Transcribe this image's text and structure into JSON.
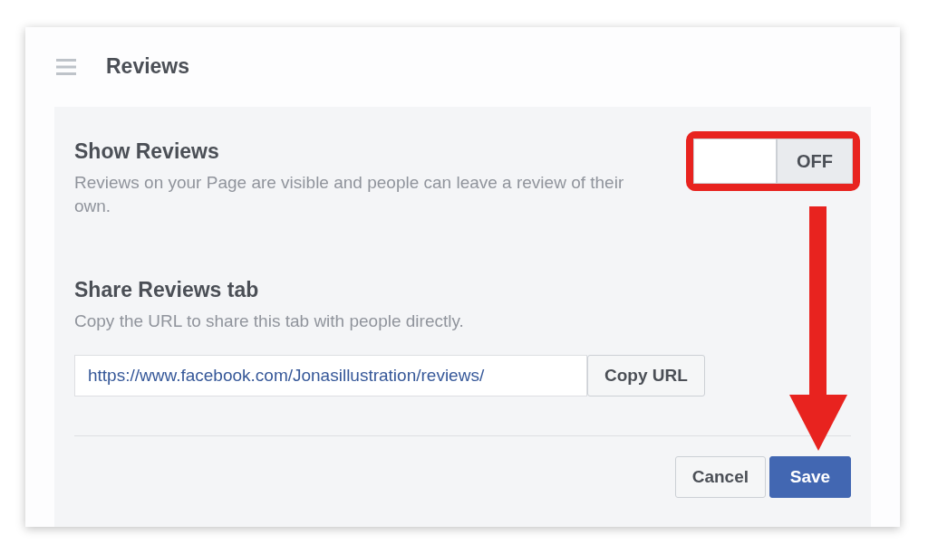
{
  "header": {
    "title": "Reviews"
  },
  "show_reviews": {
    "title": "Show Reviews",
    "description": "Reviews on your Page are visible and people can leave a review of their own.",
    "toggle": {
      "on": false,
      "label": "OFF"
    },
    "highlighted": true
  },
  "share_tab": {
    "title": "Share Reviews tab",
    "description": "Copy the URL to share this tab with people directly.",
    "url": "https://www.facebook.com/Jonasillustration/reviews/",
    "copy_button": "Copy URL"
  },
  "buttons": [
    {
      "label": "Cancel",
      "kind": "secondary"
    },
    {
      "label": "Save",
      "kind": "primary"
    }
  ]
}
